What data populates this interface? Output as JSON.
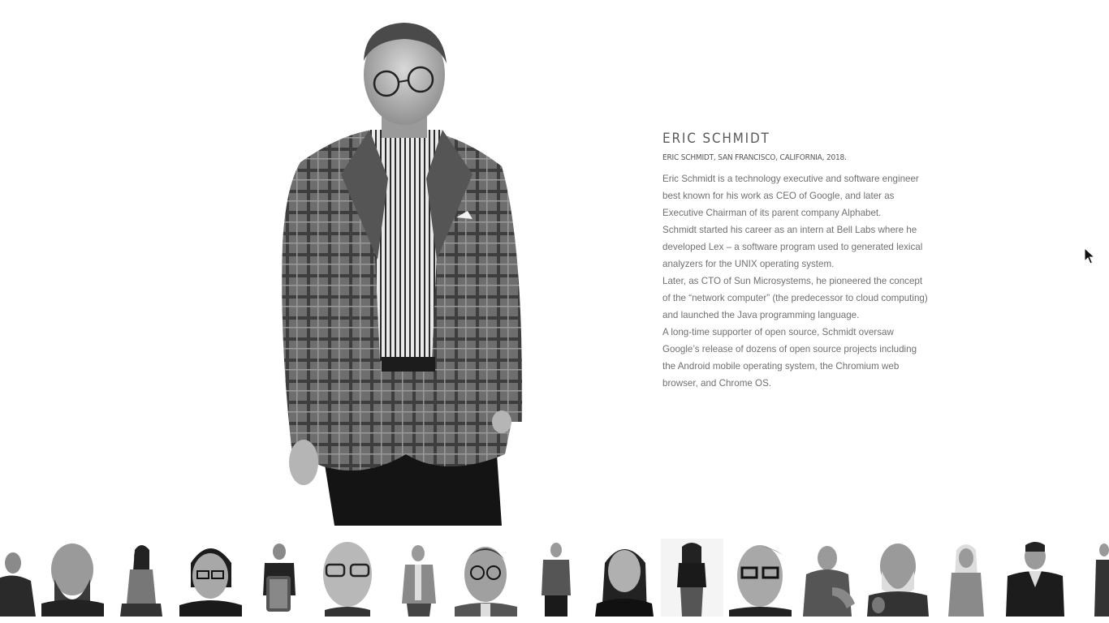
{
  "profile": {
    "name": "ERIC SCHMIDT",
    "caption": "ERIC SCHMIDT, SAN FRANCISCO, CALIFORNIA, 2018.",
    "paragraphs": [
      "Eric Schmidt is a technology executive and software engineer best known for his work as CEO of Google, and later as Executive Chairman of its parent company Alphabet.",
      "Schmidt started his career as an intern at Bell Labs where he developed Lex – a software program used to generated lexical analyzers for the UNIX operating system.",
      "Later, as CTO of Sun Microsystems, he pioneered the concept of the “network computer” (the predecessor to cloud computing) and launched the Java programming language.",
      "A long-time supporter of open source, Schmidt oversaw Google’s release of dozens of open source projects including the Android mobile operating system, the Chromium web browser, and Chrome OS."
    ]
  },
  "thumbnails": [
    {
      "tone": "dark-sweater"
    },
    {
      "tone": "bearded-man-closeup"
    },
    {
      "tone": "woman-seated"
    },
    {
      "tone": "woman-glasses-closeup"
    },
    {
      "tone": "man-holding-object"
    },
    {
      "tone": "older-man-glasses-closeup"
    },
    {
      "tone": "older-man-suit"
    },
    {
      "tone": "eric-schmidt-closeup"
    },
    {
      "tone": "man-plaid-jacket"
    },
    {
      "tone": "woman-dark-hair"
    },
    {
      "tone": "woman-polo-standing"
    },
    {
      "tone": "man-glasses-closeup"
    },
    {
      "tone": "man-tshirt-seated"
    },
    {
      "tone": "bearded-older-man"
    },
    {
      "tone": "blonde-woman"
    },
    {
      "tone": "man-dark-suit"
    },
    {
      "tone": "partial-figure"
    }
  ]
}
